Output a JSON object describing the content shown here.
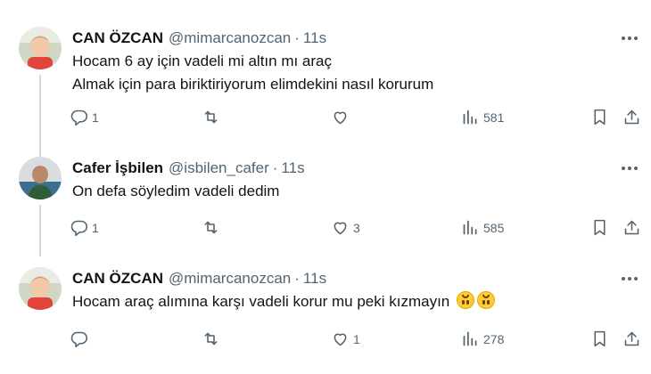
{
  "tweets": [
    {
      "name": "CAN ÖZCAN",
      "handle": "@mimarcanozcan",
      "time": "11s",
      "lines": [
        "Hocam 6 ay için vadeli mi altın mı araç",
        "Almak için para biriktiriyorum elimdekini nasıl korurum"
      ],
      "replies": "1",
      "retweets": "",
      "likes": "",
      "views": "581"
    },
    {
      "name": "Cafer İşbilen",
      "handle": "@isbilen_cafer",
      "time": "11s",
      "lines": [
        "On defa söyledim vadeli dedim"
      ],
      "replies": "1",
      "retweets": "",
      "likes": "3",
      "views": "585"
    },
    {
      "name": "CAN ÖZCAN",
      "handle": "@mimarcanozcan",
      "time": "11s",
      "lines": [
        "Hocam araç alımına karşı vadeli korur mu peki kızmayın"
      ],
      "emoji": [
        "upside-down-face",
        "upside-down-face"
      ],
      "replies": "",
      "retweets": "",
      "likes": "1",
      "views": "278"
    }
  ],
  "separator": "·",
  "icons": [
    "avatar",
    "more-icon",
    "reply-icon",
    "retweet-icon",
    "like-icon",
    "views-icon",
    "bookmark-icon",
    "share-icon"
  ],
  "colors": {
    "text": "#0f1419",
    "secondary": "#536471",
    "line": "#cfd9de"
  }
}
